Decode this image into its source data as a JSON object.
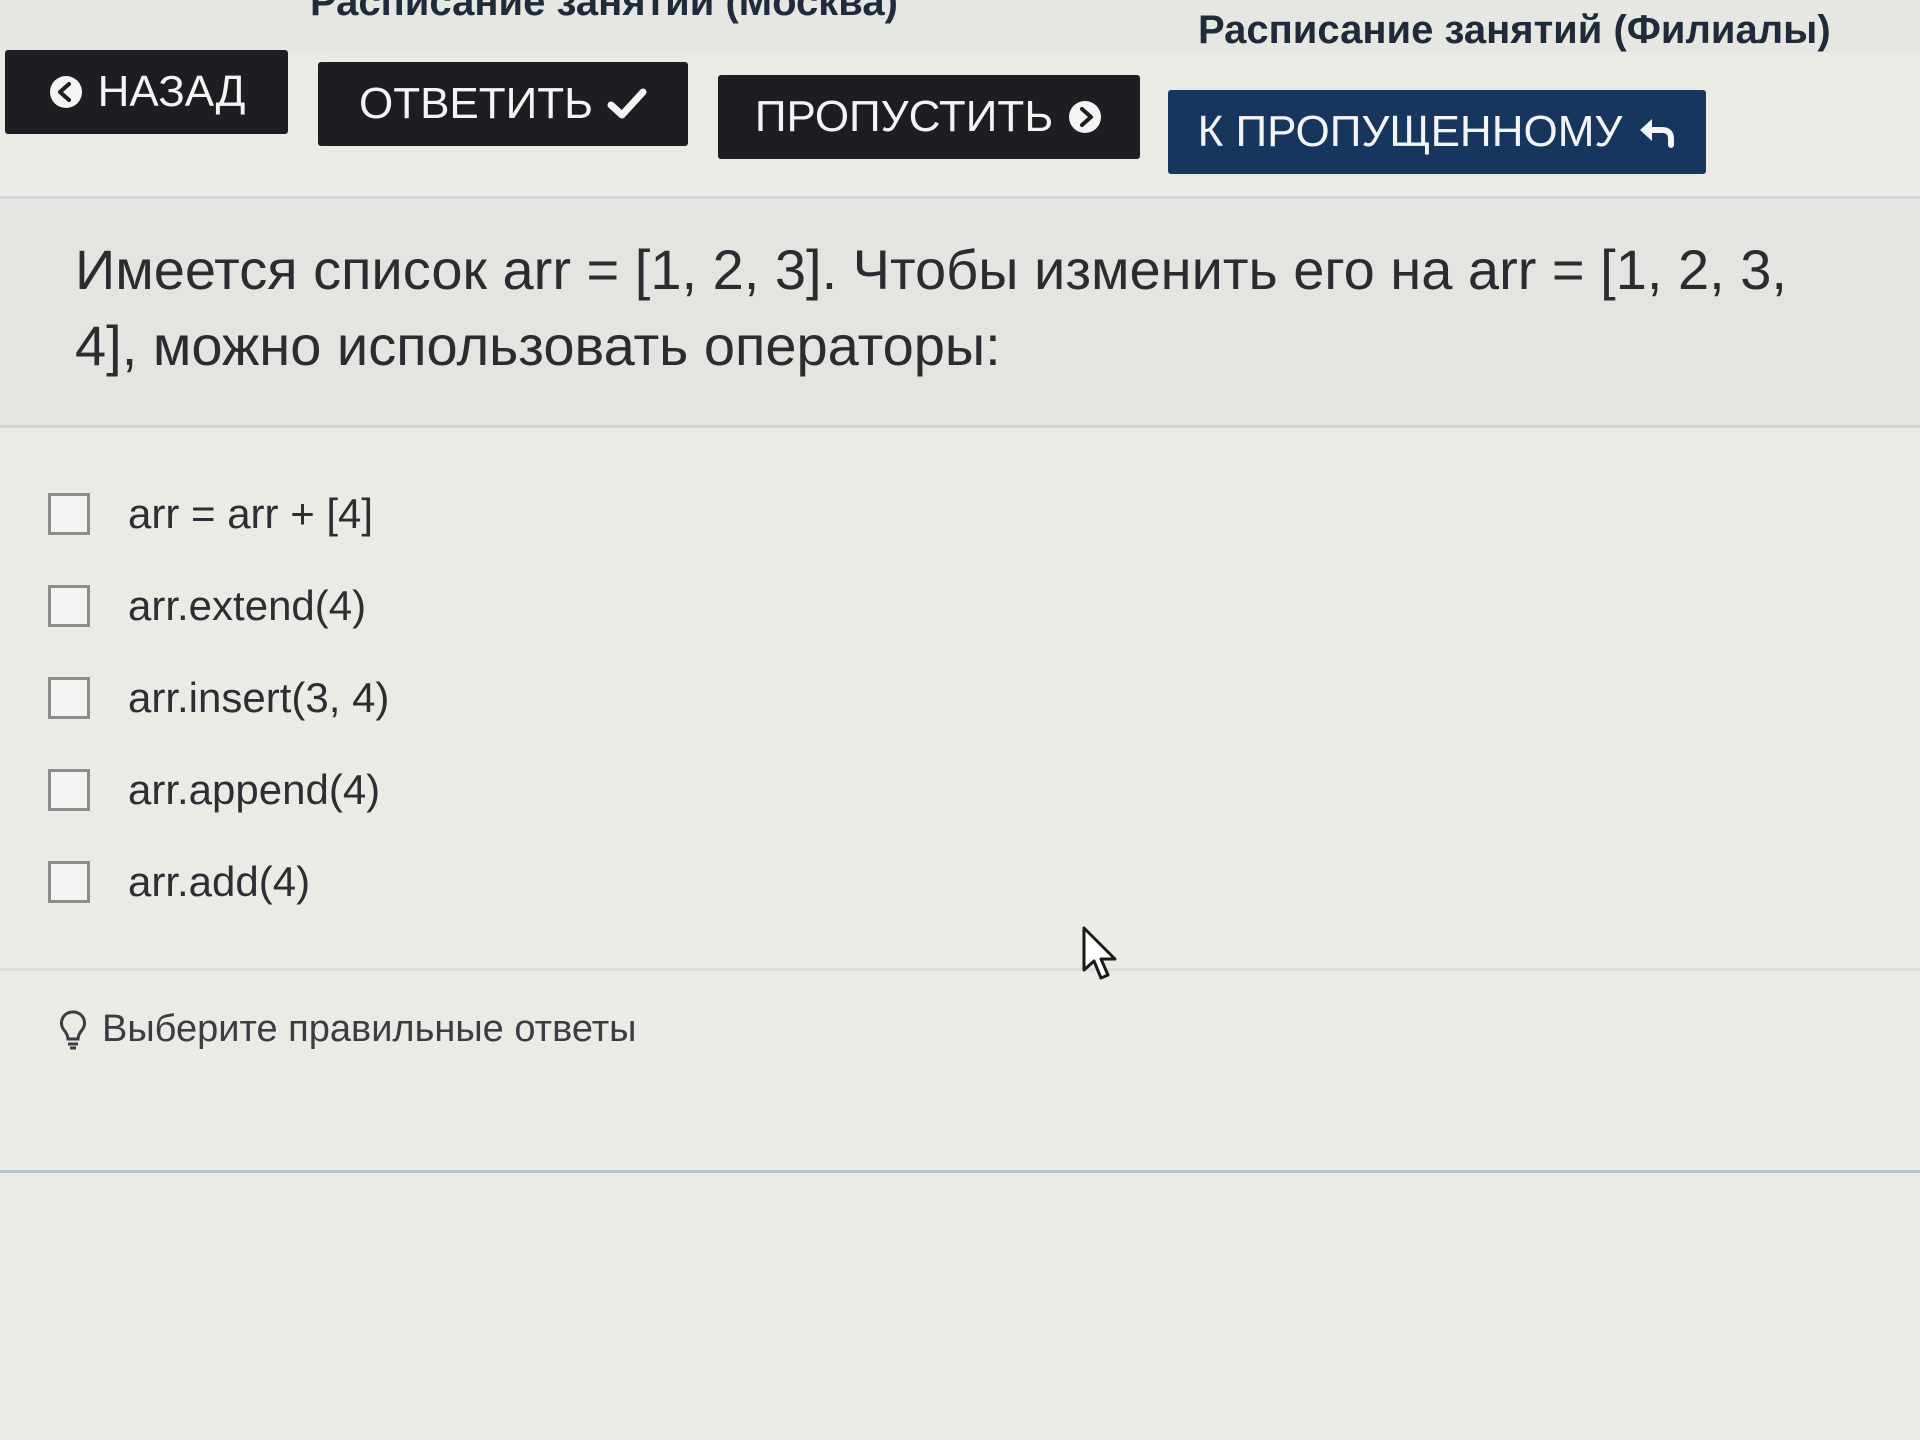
{
  "header": {
    "link_moscow": "Расписание занятий (Москва)",
    "link_branches": "Расписание занятий (Филиалы)"
  },
  "toolbar": {
    "back_label": "НАЗАД",
    "answer_label": "ОТВЕТИТЬ",
    "skip_label": "ПРОПУСТИТЬ",
    "to_skipped_label": "К ПРОПУЩЕННОМУ",
    "colors": {
      "dark_button": "#1d1e21",
      "blue_button": "#17365e",
      "button_text": "#f4f4f4"
    },
    "icons": {
      "back": "circle-arrow-left-icon",
      "answer": "checkmark-icon",
      "skip": "circle-arrow-right-icon",
      "to_skipped": "reply-arrow-icon"
    }
  },
  "question": {
    "text": "Имеется список arr = [1, 2, 3]. Чтобы изменить его на arr = [1, 2, 3, 4], можно использовать операторы:"
  },
  "options": [
    {
      "label": "arr = arr + [4]",
      "checked": false
    },
    {
      "label": "arr.extend(4)",
      "checked": false
    },
    {
      "label": "arr.insert(3, 4)",
      "checked": false
    },
    {
      "label": "arr.append(4)",
      "checked": false
    },
    {
      "label": "arr.add(4)",
      "checked": false
    }
  ],
  "hint": {
    "icon": "lightbulb-icon",
    "text": "Выберите правильные ответы"
  }
}
